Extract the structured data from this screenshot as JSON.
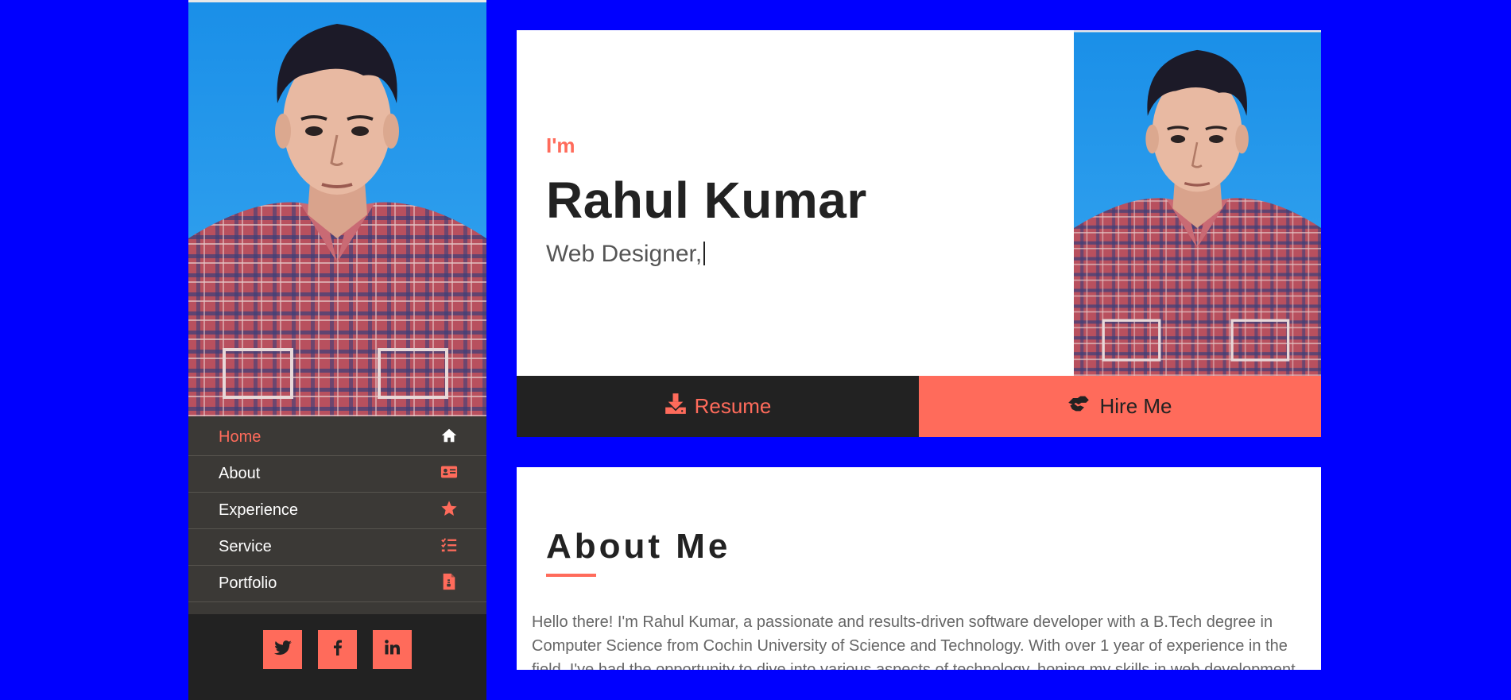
{
  "sidebar": {
    "nav": [
      {
        "label": "Home",
        "icon": "home-icon",
        "active": true
      },
      {
        "label": "About",
        "icon": "id-card-icon"
      },
      {
        "label": "Experience",
        "icon": "star-icon"
      },
      {
        "label": "Service",
        "icon": "list-check-icon"
      },
      {
        "label": "Portfolio",
        "icon": "file-icon"
      }
    ],
    "social": [
      "twitter-icon",
      "facebook-icon",
      "linkedin-icon"
    ]
  },
  "hero": {
    "intro": "I'm",
    "name": "Rahul Kumar",
    "role": "Web Designer,",
    "resume_label": "Resume",
    "hire_label": "Hire Me"
  },
  "about": {
    "title": "About Me",
    "text": "Hello there! I'm Rahul Kumar, a passionate and results-driven software developer with a B.Tech degree in Computer Science from Cochin University of Science and Technology. With over 1 year of experience in the field, I've had the opportunity to dive into various aspects of technology, honing my skills in web development"
  },
  "colors": {
    "background": "#0000ff",
    "accent": "#ff6b5b",
    "dark": "#222222",
    "nav_bg": "#3b3936"
  }
}
